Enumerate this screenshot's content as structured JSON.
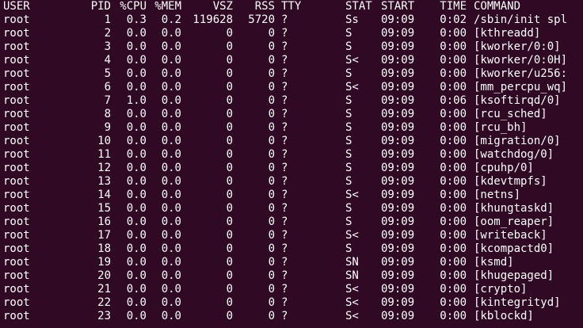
{
  "header": {
    "user": "USER",
    "pid": "PID",
    "cpu": "%CPU",
    "mem": "%MEM",
    "vsz": "VSZ",
    "rss": "RSS",
    "tty": "TTY",
    "stat": "STAT",
    "start": "START",
    "time": "TIME",
    "command": "COMMAND"
  },
  "rows": [
    {
      "user": "root",
      "pid": "1",
      "cpu": "0.3",
      "mem": "0.2",
      "vsz": "119628",
      "rss": "5720",
      "tty": "?",
      "stat": "Ss",
      "start": "09:09",
      "time": "0:02",
      "command": "/sbin/init spl"
    },
    {
      "user": "root",
      "pid": "2",
      "cpu": "0.0",
      "mem": "0.0",
      "vsz": "0",
      "rss": "0",
      "tty": "?",
      "stat": "S",
      "start": "09:09",
      "time": "0:00",
      "command": "[kthreadd]"
    },
    {
      "user": "root",
      "pid": "3",
      "cpu": "0.0",
      "mem": "0.0",
      "vsz": "0",
      "rss": "0",
      "tty": "?",
      "stat": "S",
      "start": "09:09",
      "time": "0:00",
      "command": "[kworker/0:0]"
    },
    {
      "user": "root",
      "pid": "4",
      "cpu": "0.0",
      "mem": "0.0",
      "vsz": "0",
      "rss": "0",
      "tty": "?",
      "stat": "S<",
      "start": "09:09",
      "time": "0:00",
      "command": "[kworker/0:0H]"
    },
    {
      "user": "root",
      "pid": "5",
      "cpu": "0.0",
      "mem": "0.0",
      "vsz": "0",
      "rss": "0",
      "tty": "?",
      "stat": "S",
      "start": "09:09",
      "time": "0:00",
      "command": "[kworker/u256:"
    },
    {
      "user": "root",
      "pid": "6",
      "cpu": "0.0",
      "mem": "0.0",
      "vsz": "0",
      "rss": "0",
      "tty": "?",
      "stat": "S<",
      "start": "09:09",
      "time": "0:00",
      "command": "[mm_percpu_wq]"
    },
    {
      "user": "root",
      "pid": "7",
      "cpu": "1.0",
      "mem": "0.0",
      "vsz": "0",
      "rss": "0",
      "tty": "?",
      "stat": "S",
      "start": "09:09",
      "time": "0:06",
      "command": "[ksoftirqd/0]"
    },
    {
      "user": "root",
      "pid": "8",
      "cpu": "0.0",
      "mem": "0.0",
      "vsz": "0",
      "rss": "0",
      "tty": "?",
      "stat": "S",
      "start": "09:09",
      "time": "0:00",
      "command": "[rcu_sched]"
    },
    {
      "user": "root",
      "pid": "9",
      "cpu": "0.0",
      "mem": "0.0",
      "vsz": "0",
      "rss": "0",
      "tty": "?",
      "stat": "S",
      "start": "09:09",
      "time": "0:00",
      "command": "[rcu_bh]"
    },
    {
      "user": "root",
      "pid": "10",
      "cpu": "0.0",
      "mem": "0.0",
      "vsz": "0",
      "rss": "0",
      "tty": "?",
      "stat": "S",
      "start": "09:09",
      "time": "0:00",
      "command": "[migration/0]"
    },
    {
      "user": "root",
      "pid": "11",
      "cpu": "0.0",
      "mem": "0.0",
      "vsz": "0",
      "rss": "0",
      "tty": "?",
      "stat": "S",
      "start": "09:09",
      "time": "0:00",
      "command": "[watchdog/0]"
    },
    {
      "user": "root",
      "pid": "12",
      "cpu": "0.0",
      "mem": "0.0",
      "vsz": "0",
      "rss": "0",
      "tty": "?",
      "stat": "S",
      "start": "09:09",
      "time": "0:00",
      "command": "[cpuhp/0]"
    },
    {
      "user": "root",
      "pid": "13",
      "cpu": "0.0",
      "mem": "0.0",
      "vsz": "0",
      "rss": "0",
      "tty": "?",
      "stat": "S",
      "start": "09:09",
      "time": "0:00",
      "command": "[kdevtmpfs]"
    },
    {
      "user": "root",
      "pid": "14",
      "cpu": "0.0",
      "mem": "0.0",
      "vsz": "0",
      "rss": "0",
      "tty": "?",
      "stat": "S<",
      "start": "09:09",
      "time": "0:00",
      "command": "[netns]"
    },
    {
      "user": "root",
      "pid": "15",
      "cpu": "0.0",
      "mem": "0.0",
      "vsz": "0",
      "rss": "0",
      "tty": "?",
      "stat": "S",
      "start": "09:09",
      "time": "0:00",
      "command": "[khungtaskd]"
    },
    {
      "user": "root",
      "pid": "16",
      "cpu": "0.0",
      "mem": "0.0",
      "vsz": "0",
      "rss": "0",
      "tty": "?",
      "stat": "S",
      "start": "09:09",
      "time": "0:00",
      "command": "[oom_reaper]"
    },
    {
      "user": "root",
      "pid": "17",
      "cpu": "0.0",
      "mem": "0.0",
      "vsz": "0",
      "rss": "0",
      "tty": "?",
      "stat": "S<",
      "start": "09:09",
      "time": "0:00",
      "command": "[writeback]"
    },
    {
      "user": "root",
      "pid": "18",
      "cpu": "0.0",
      "mem": "0.0",
      "vsz": "0",
      "rss": "0",
      "tty": "?",
      "stat": "S",
      "start": "09:09",
      "time": "0:00",
      "command": "[kcompactd0]"
    },
    {
      "user": "root",
      "pid": "19",
      "cpu": "0.0",
      "mem": "0.0",
      "vsz": "0",
      "rss": "0",
      "tty": "?",
      "stat": "SN",
      "start": "09:09",
      "time": "0:00",
      "command": "[ksmd]"
    },
    {
      "user": "root",
      "pid": "20",
      "cpu": "0.0",
      "mem": "0.0",
      "vsz": "0",
      "rss": "0",
      "tty": "?",
      "stat": "SN",
      "start": "09:09",
      "time": "0:00",
      "command": "[khugepaged]"
    },
    {
      "user": "root",
      "pid": "21",
      "cpu": "0.0",
      "mem": "0.0",
      "vsz": "0",
      "rss": "0",
      "tty": "?",
      "stat": "S<",
      "start": "09:09",
      "time": "0:00",
      "command": "[crypto]"
    },
    {
      "user": "root",
      "pid": "22",
      "cpu": "0.0",
      "mem": "0.0",
      "vsz": "0",
      "rss": "0",
      "tty": "?",
      "stat": "S<",
      "start": "09:09",
      "time": "0:00",
      "command": "[kintegrityd]"
    },
    {
      "user": "root",
      "pid": "23",
      "cpu": "0.0",
      "mem": "0.0",
      "vsz": "0",
      "rss": "0",
      "tty": "?",
      "stat": "S<",
      "start": "09:09",
      "time": "0:00",
      "command": "[kblockd]"
    }
  ],
  "colors": {
    "background": "#300a24",
    "foreground": "#ffffff"
  }
}
